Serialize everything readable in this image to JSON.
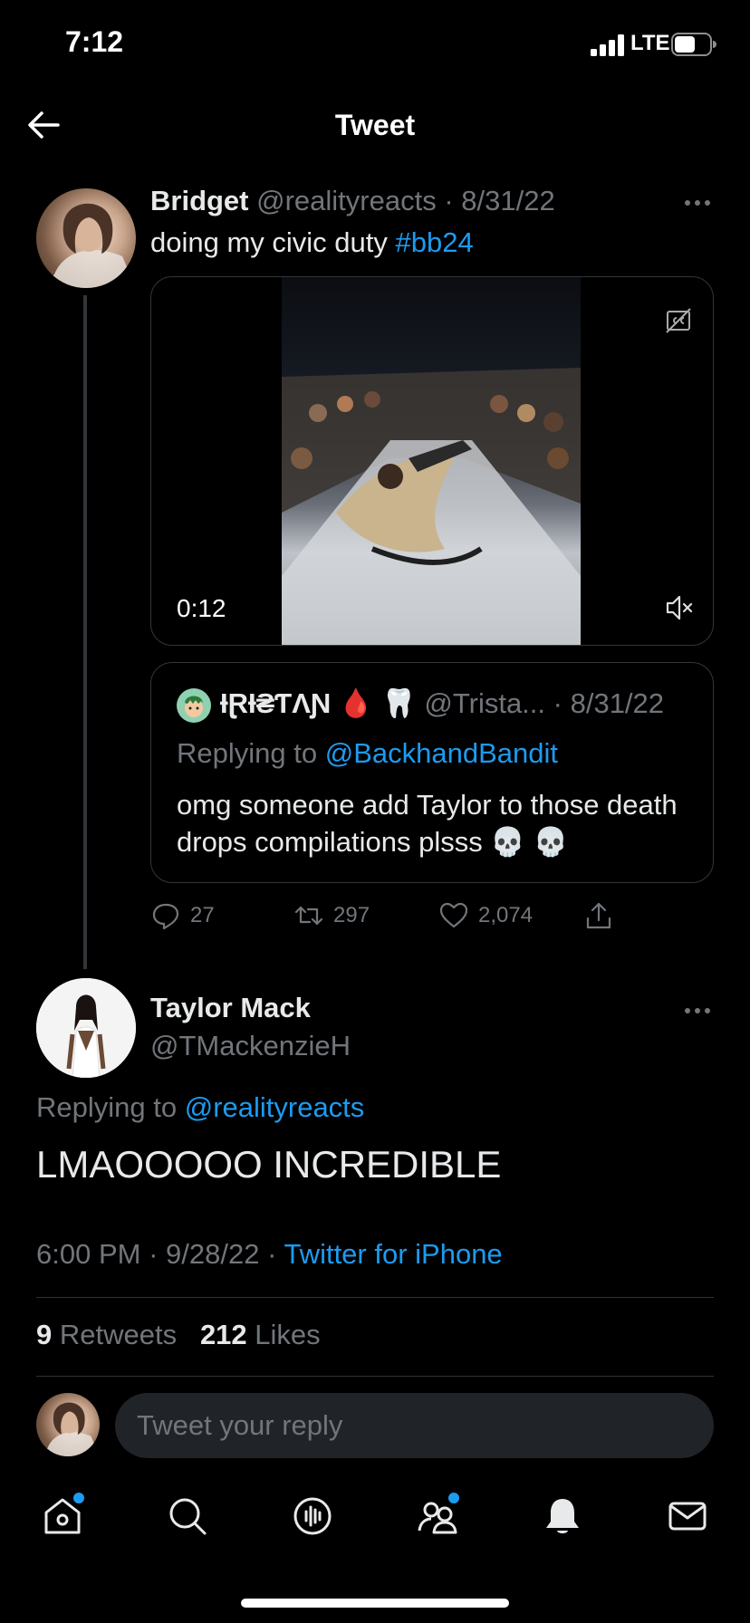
{
  "status_bar": {
    "time": "7:12",
    "network": "LTE"
  },
  "header": {
    "title": "Tweet"
  },
  "tweet": {
    "author_name": "Bridget",
    "author_handle": "@realityreacts",
    "separator": "·",
    "date": "8/31/22",
    "text": "doing my civic duty ",
    "hashtag": "#bb24",
    "video": {
      "duration": "0:12"
    },
    "quote": {
      "author_name": "ƗⱤƗ₴ƬΛƝ",
      "emoji": "🩸 🦷",
      "author_handle": "@Trista...",
      "date": "8/31/22",
      "replying_label": "Replying to ",
      "replying_to": "@BackhandBandit",
      "text": "omg someone add Taylor to those death drops compilations plsss 💀 💀"
    },
    "stats": {
      "replies": "27",
      "retweets": "297",
      "likes": "2,074"
    }
  },
  "reply_tweet": {
    "author_name": "Taylor Mack",
    "author_handle": "@TMackenzieH",
    "replying_label": "Replying to ",
    "replying_to": "@realityreacts",
    "text": "LMAOOOOO INCREDIBLE",
    "time": "6:00 PM",
    "date": "9/28/22",
    "source": "Twitter for iPhone",
    "retweets_count": "9",
    "retweets_label": " Retweets",
    "likes_count": "212",
    "likes_label": " Likes"
  },
  "composer": {
    "placeholder": "Tweet your reply"
  },
  "tab_bar": {
    "items": [
      "home-icon",
      "search-icon",
      "spaces-icon",
      "communities-icon",
      "notifications-icon",
      "messages-icon"
    ]
  },
  "colors": {
    "accent": "#1d9bf0",
    "background": "#000000",
    "muted": "#71767b"
  }
}
